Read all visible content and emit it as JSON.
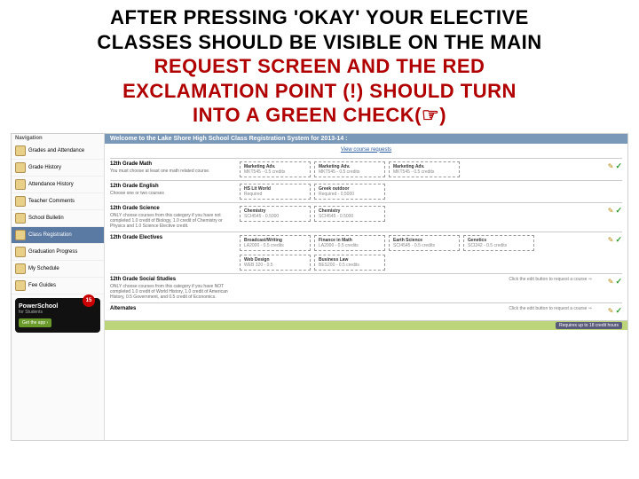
{
  "title": {
    "line1": "AFTER PRESSING 'OKAY' YOUR ELECTIVE",
    "line2": "CLASSES SHOULD BE VISIBLE ON THE MAIN",
    "line3": "REQUEST SCREEN AND THE RED",
    "line4": "EXCLAMATION POINT (!) SHOULD TURN",
    "line5": "INTO A GREEN CHECK(☞)"
  },
  "sidebar": {
    "header": "Navigation",
    "items": [
      {
        "label": "Grades and Attendance"
      },
      {
        "label": "Grade History"
      },
      {
        "label": "Attendance History"
      },
      {
        "label": "Teacher Comments"
      },
      {
        "label": "School Bulletin"
      },
      {
        "label": "Class Registration"
      },
      {
        "label": "Graduation Progress"
      },
      {
        "label": "My Schedule"
      },
      {
        "label": "Fee Guides"
      }
    ],
    "promo": {
      "badge": "15",
      "title": "PowerSchool",
      "subtitle": "for Students",
      "button": "Get the app ›"
    }
  },
  "main": {
    "welcome": "Welcome to the Lake Shore High School Class Registration System for 2013-14 :",
    "link": "View course requests",
    "sections": [
      {
        "title": "12th Grade Math",
        "desc": "You must choose at least one math related course.",
        "courses": [
          {
            "name": "Marketing Adv.",
            "code": "MKT545 - 0.5 credits"
          },
          {
            "name": "Marketing Adv.",
            "code": "MKT545 - 0.5 credits"
          },
          {
            "name": "Marketing Adv.",
            "code": "MKT545 - 0.5 credits"
          }
        ],
        "status": "check"
      },
      {
        "title": "12th Grade English",
        "desc": "Choose one or two courses",
        "courses": [
          {
            "name": "HS Lit World",
            "code": "Required"
          },
          {
            "name": "Greek outdoor",
            "code": "Required - 0.5000"
          }
        ],
        "status": "none"
      },
      {
        "title": "12th Grade Science",
        "desc": "ONLY choose courses from this category if you have not completed 1.0 credit of Biology, 1.0 credit of Chemistry or Physics and 1.0 Science Elective credit.",
        "courses": [
          {
            "name": "Chemistry",
            "code": "SCI4545 - 0.5000"
          },
          {
            "name": "Chemistry",
            "code": "SCI4545 - 0.5000"
          }
        ],
        "status": "check"
      },
      {
        "title": "12th Grade Electives",
        "desc": "",
        "courses": [
          {
            "name": "Broadcast/Writing",
            "code": "LA2000 - 0.5 credits"
          },
          {
            "name": "Finance in Math",
            "code": "LA2000 - 0.5 credits"
          },
          {
            "name": "Earth Science",
            "code": "SCI4545 - 0.5 credits"
          },
          {
            "name": "Genetics",
            "code": "SCI242 - 0.5 credits"
          },
          {
            "name": "Web Design",
            "code": "WEB 320 - 0.5"
          },
          {
            "name": "Business Law",
            "code": "BES200 - 0.5 credits"
          }
        ],
        "status": "check"
      },
      {
        "title": "12th Grade Social Studies",
        "desc": "ONLY choose courses from this category if you have NOT completed 1.0 credit of World History, 1.0 credit of American History, 0.5 Government, and 0.5 credit of Economics.",
        "msg": "Click the edit button to request a course ⇒",
        "status": "check"
      },
      {
        "title": "Alternates",
        "desc": "",
        "msg": "Click the edit button to request a course ⇒",
        "status": "check"
      }
    ],
    "footer": "Requires up to 18 credit hours"
  }
}
